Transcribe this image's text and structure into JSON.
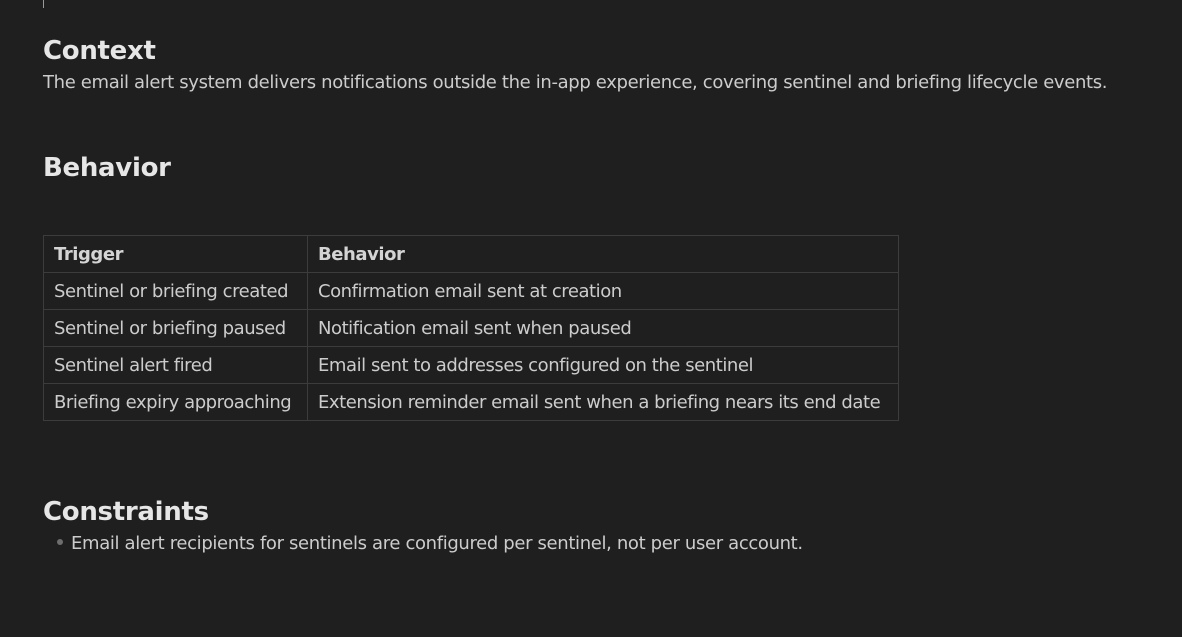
{
  "context": {
    "heading": "Context",
    "text": "The email alert system delivers notifications outside the in-app experience, covering sentinel and briefing lifecycle events."
  },
  "behavior": {
    "heading": "Behavior",
    "table": {
      "headers": [
        "Trigger",
        "Behavior"
      ],
      "rows": [
        [
          "Sentinel or briefing created",
          "Confirmation email sent at creation"
        ],
        [
          "Sentinel or briefing paused",
          "Notification email sent when paused"
        ],
        [
          "Sentinel alert fired",
          "Email sent to addresses configured on the sentinel"
        ],
        [
          "Briefing expiry approaching",
          "Extension reminder email sent when a briefing nears its end date"
        ]
      ]
    }
  },
  "constraints": {
    "heading": "Constraints",
    "items": [
      "Email alert recipients for sentinels are configured per sentinel, not per user account."
    ]
  },
  "colors": {
    "background": "#1f1f1f",
    "text": "#cccccc",
    "heading": "#e6e6e6",
    "table_border": "#3c3c3c"
  }
}
